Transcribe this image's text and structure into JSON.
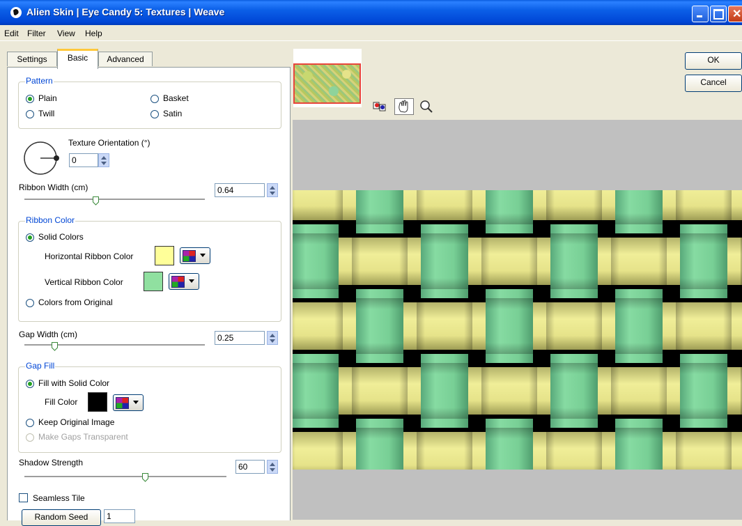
{
  "window": {
    "title": "Alien Skin | Eye Candy 5: Textures | Weave"
  },
  "menu": [
    "Edit",
    "Filter",
    "View",
    "Help"
  ],
  "tabs": {
    "settings": "Settings",
    "basic": "Basic",
    "advanced": "Advanced",
    "active": "Basic"
  },
  "pattern": {
    "legend": "Pattern",
    "plain": "Plain",
    "basket": "Basket",
    "twill": "Twill",
    "satin": "Satin",
    "selected": "Plain"
  },
  "orientation": {
    "label": "Texture Orientation (°)",
    "value": "0"
  },
  "ribbon_width": {
    "label": "Ribbon Width (cm)",
    "value": "0.64"
  },
  "ribbon_color": {
    "legend": "Ribbon Color",
    "solid": "Solid Colors",
    "horizontal_label": "Horizontal Ribbon Color",
    "horizontal_color": "#ffff99",
    "vertical_label": "Vertical Ribbon Color",
    "vertical_color": "#90e0a0",
    "from_original": "Colors from Original",
    "selected": "Solid Colors"
  },
  "gap_width": {
    "label": "Gap Width (cm)",
    "value": "0.25"
  },
  "gap_fill": {
    "legend": "Gap Fill",
    "solid": "Fill with Solid Color",
    "fill_label": "Fill Color",
    "fill_color": "#000000",
    "keep": "Keep Original Image",
    "transparent": "Make Gaps Transparent",
    "selected": "Fill with Solid Color"
  },
  "shadow": {
    "label": "Shadow Strength",
    "value": "60"
  },
  "seamless": {
    "label": "Seamless Tile",
    "checked": false
  },
  "random_seed": {
    "button": "Random Seed",
    "value": "1"
  },
  "buttons": {
    "ok": "OK",
    "cancel": "Cancel"
  },
  "tools": [
    "compare-icon",
    "hand-icon",
    "zoom-icon"
  ],
  "colors": {
    "title_bar": "#0b5fe7",
    "accent_legend": "#0046d5",
    "weave_yellow": "#e6e38a",
    "weave_green": "#78cf95"
  }
}
